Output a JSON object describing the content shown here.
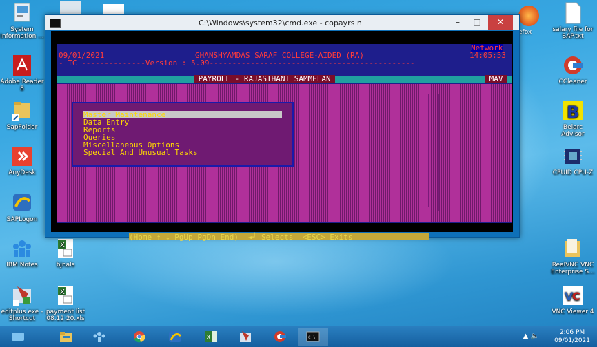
{
  "desktop": {
    "left_icons": [
      {
        "label": "System Information ...",
        "icon": "system-info-icon"
      },
      {
        "label": "Adobe Reader 8",
        "icon": "adobe-reader-icon"
      },
      {
        "label": "SapFolder",
        "icon": "folder-icon"
      },
      {
        "label": "AnyDesk",
        "icon": "anydesk-icon"
      },
      {
        "label": "SAPLogon",
        "icon": "sap-logon-icon"
      },
      {
        "label": "IBM Notes",
        "icon": "ibm-notes-icon"
      },
      {
        "label": "editplus.exe - Shortcut",
        "icon": "editplus-icon"
      }
    ],
    "second_col_icons": [
      {
        "label": "bjnals",
        "icon": "excel-file-icon"
      },
      {
        "label": "payment list 08.12.20.xls",
        "icon": "excel-file-icon"
      }
    ],
    "right_icons": [
      {
        "label": "salary file for SAP.txt",
        "icon": "text-file-icon"
      },
      {
        "label": "CCleaner",
        "icon": "ccleaner-icon"
      },
      {
        "label": "Belarc Advisor",
        "icon": "belarc-icon"
      },
      {
        "label": "CPUID CPU-Z",
        "icon": "cpuz-icon"
      },
      {
        "label": "RealVNC VNC Enterprise S...",
        "icon": "folder-icon"
      },
      {
        "label": "VNC Viewer 4",
        "icon": "vnc-icon"
      }
    ],
    "partial_label": "efox"
  },
  "window": {
    "title": "C:\\Windows\\system32\\cmd.exe - copayrs n",
    "minimize": "–",
    "maximize": "□",
    "close": "✕"
  },
  "app": {
    "network": "Network",
    "date": "09/01/2021",
    "college": "GHANSHYAMDAS SARAF COLLEGE-AIDED (RA)",
    "time": "14:05:53",
    "tc_line": "- TC --------------Version : 5.09---------------------------------------------",
    "payroll": " PAYROLL - RAJASTHANI SAMMELAN ",
    "user": " MAV ",
    "menu": [
      "Master Maintenance",
      "Data Entry",
      "Reports",
      "Queries",
      "Miscellaneous Options",
      "Special And Unusual Tasks"
    ],
    "status": "(Home ↑ ↓ PgUp PgDn End)  ◄┘ Selects  <ESC> Exits "
  },
  "taskbar": {
    "items": [
      "start",
      "file-explorer",
      "ibm-notes",
      "chrome",
      "sap-logon",
      "excel",
      "editplus",
      "ccleaner",
      "cmd"
    ],
    "time": "2:06 PM",
    "date": "09/01/2021",
    "tray": "▲  🔈"
  },
  "colors": {
    "console_red": "#ff3b3b",
    "menu_yellow": "#ffd800",
    "payroll_bg": "#7a0d2a"
  }
}
